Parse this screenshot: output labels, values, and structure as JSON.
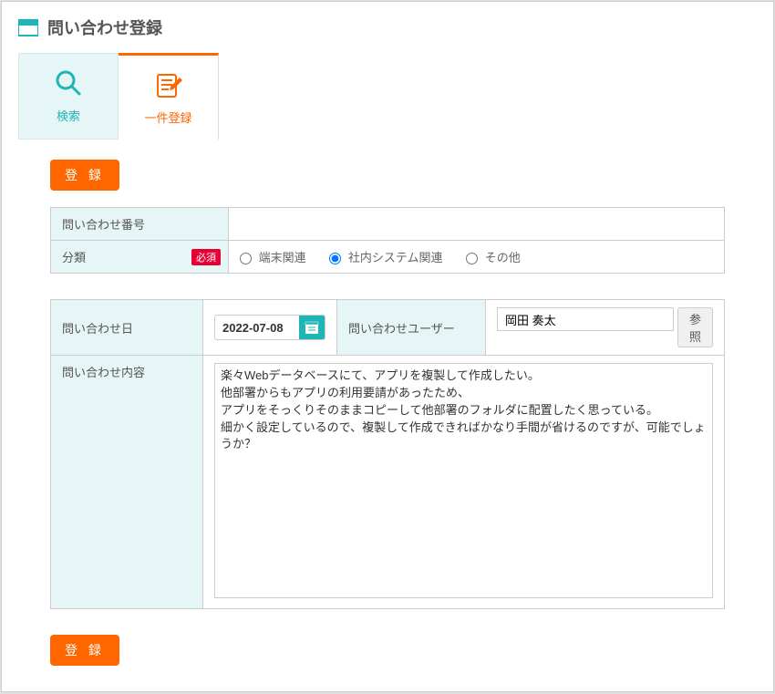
{
  "header": {
    "title": "問い合わせ登録"
  },
  "tabs": {
    "search": {
      "label": "検索"
    },
    "register": {
      "label": "一件登録"
    }
  },
  "buttons": {
    "register": "登 録",
    "reference": "参照"
  },
  "form": {
    "inquiry_number": {
      "label": "問い合わせ番号",
      "value": ""
    },
    "category": {
      "label": "分類",
      "required_badge": "必須",
      "options": [
        {
          "value": "terminal",
          "label": "端末関連",
          "checked": false
        },
        {
          "value": "internal",
          "label": "社内システム関連",
          "checked": true
        },
        {
          "value": "other",
          "label": "その他",
          "checked": false
        }
      ]
    },
    "inquiry_date": {
      "label": "問い合わせ日",
      "value": "2022-07-08"
    },
    "inquiry_user": {
      "label": "問い合わせユーザー",
      "value": "岡田 奏太"
    },
    "inquiry_content": {
      "label": "問い合わせ内容",
      "value": "楽々Webデータベースにて、アプリを複製して作成したい。\n他部署からもアプリの利用要請があったため、\nアプリをそっくりそのままコピーして他部署のフォルダに配置したく思っている。\n細かく設定しているので、複製して作成できればかなり手間が省けるのですが、可能でしょうか？"
    }
  },
  "colors": {
    "accent_orange": "#ff6600",
    "accent_teal": "#1db5b5",
    "required_red": "#e60033"
  }
}
